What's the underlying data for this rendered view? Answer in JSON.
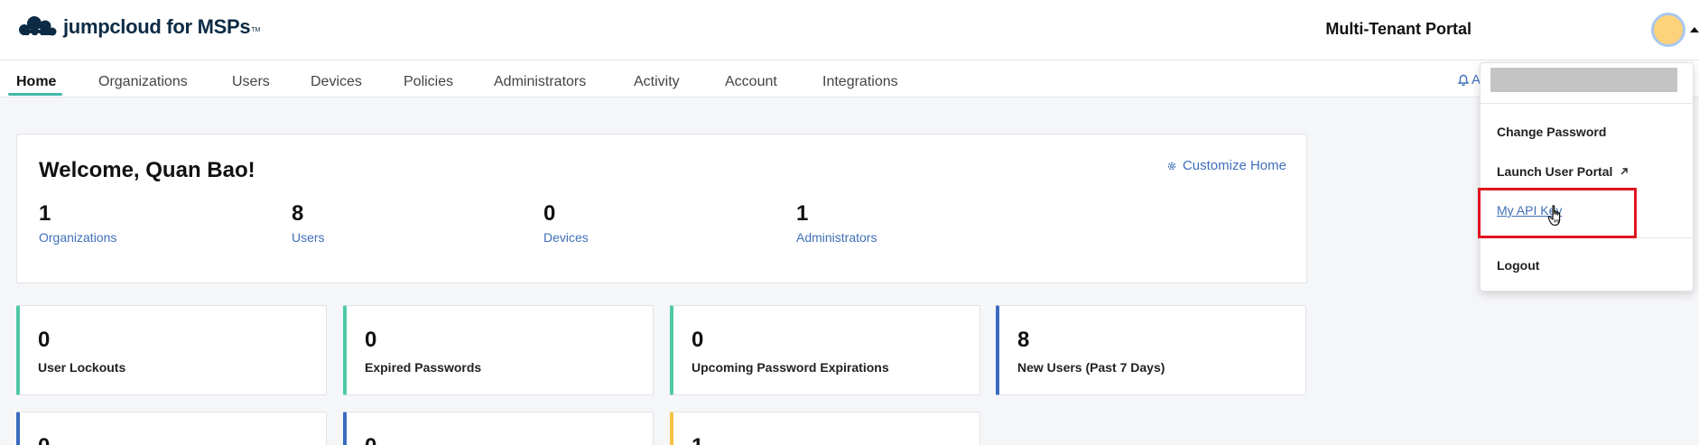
{
  "header": {
    "logo_text": "jumpcloud for MSPs",
    "logo_tm": "TM",
    "portal_title": "Multi-Tenant Portal"
  },
  "nav": {
    "items": [
      "Home",
      "Organizations",
      "Users",
      "Devices",
      "Policies",
      "Administrators",
      "Activity",
      "Account",
      "Integrations"
    ],
    "active": "Home",
    "partial_label": "A"
  },
  "welcome": {
    "title": "Welcome, Quan Bao!",
    "customize_label": "Customize Home",
    "stats": [
      {
        "value": "1",
        "label": "Organizations"
      },
      {
        "value": "8",
        "label": "Users"
      },
      {
        "value": "0",
        "label": "Devices"
      },
      {
        "value": "1",
        "label": "Administrators"
      }
    ]
  },
  "metrics": [
    {
      "value": "0",
      "label": "User Lockouts",
      "color": "#4fc9a5"
    },
    {
      "value": "0",
      "label": "Expired Passwords",
      "color": "#4fc9a5"
    },
    {
      "value": "0",
      "label": "Upcoming Password Expirations",
      "color": "#4fc9a5"
    },
    {
      "value": "8",
      "label": "New Users (Past 7 Days)",
      "color": "#3a6bbf"
    }
  ],
  "metrics_row2": [
    {
      "value": "0",
      "color": "#3a6bbf"
    },
    {
      "value": "0",
      "color": "#3a6bbf"
    },
    {
      "value": "1",
      "color": "#f5c243"
    }
  ],
  "user_menu": {
    "items": [
      {
        "label": "Change Password"
      },
      {
        "label": "Launch User Portal"
      },
      {
        "label": "My API Key"
      },
      {
        "label": "Logout"
      }
    ],
    "highlight_color": "#e0151f"
  }
}
